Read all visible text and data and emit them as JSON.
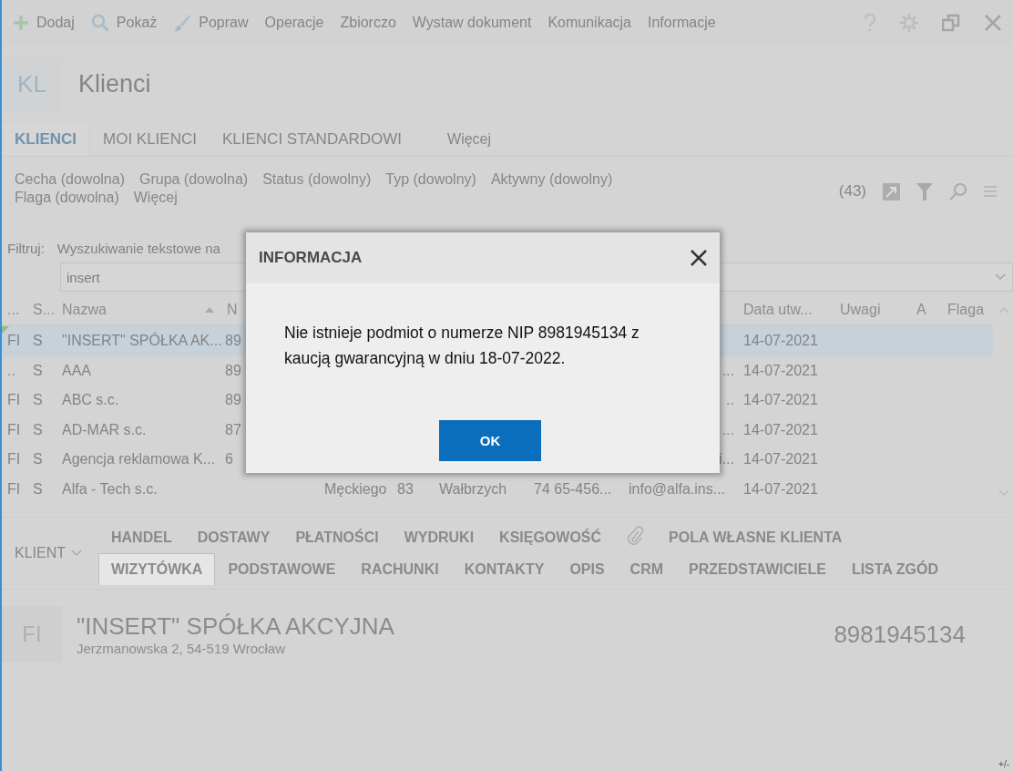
{
  "toolbar": {
    "items": [
      {
        "kind": "add",
        "label": "Dodaj"
      },
      {
        "kind": "search",
        "label": "Pokaż"
      },
      {
        "kind": "brush",
        "label": "Popraw"
      },
      {
        "kind": "menu",
        "label": "Operacje"
      },
      {
        "kind": "menu",
        "label": "Zbiorczo"
      },
      {
        "kind": "menu",
        "label": "Wystaw dokument"
      },
      {
        "kind": "menu",
        "label": "Komunikacja"
      },
      {
        "kind": "menu",
        "label": "Informacje"
      }
    ]
  },
  "module": {
    "badge": "KL",
    "title": "Klienci"
  },
  "tabs": [
    {
      "label": "KLIENCI",
      "selected": true
    },
    {
      "label": "MOI KLIENCI",
      "selected": false
    },
    {
      "label": "KLIENCI STANDARDOWI",
      "selected": false
    }
  ],
  "tabs_more": "Więcej",
  "filters": {
    "line_1": [
      "Cecha (dowolna)",
      "Grupa (dowolna)",
      "Status (dowolny)",
      "Typ (dowolny)",
      "Aktywny (dowolny)"
    ],
    "line_2": [
      "Flaga (dowolna)",
      "Więcej"
    ],
    "count": "(43)"
  },
  "search": {
    "label": "Filtruj:",
    "mode": "Wyszukiwanie tekstowe na",
    "value": "insert"
  },
  "table": {
    "columns": [
      {
        "label": "..."
      },
      {
        "label": "S..."
      },
      {
        "label": "Nazwa",
        "sorted": true
      },
      {
        "label": "N"
      },
      {},
      {},
      {},
      {},
      {},
      {
        "label": "Data utw..."
      },
      {
        "label": "Uwagi"
      },
      {
        "label": "A"
      },
      {
        "label": "Flaga"
      }
    ],
    "rows": [
      {
        "selected": true,
        "cells": [
          "FI",
          "S",
          "\"INSERT\" SPÓŁKA AK...",
          "89",
          "",
          "",
          "",
          "",
          "",
          "14-07-2021"
        ]
      },
      {
        "selected": false,
        "cells": [
          "..",
          "S",
          "AAA",
          "89",
          "",
          "",
          "",
          "",
          "...",
          "14-07-2021"
        ]
      },
      {
        "selected": false,
        "cells": [
          "FI",
          "S",
          "ABC s.c.",
          "89",
          "",
          "",
          "",
          "",
          "..",
          "14-07-2021"
        ]
      },
      {
        "selected": false,
        "cells": [
          "FI",
          "S",
          "AD-MAR s.c.",
          "87",
          "",
          "",
          "",
          "",
          "...",
          "14-07-2021"
        ]
      },
      {
        "selected": false,
        "cells": [
          "FI",
          "S",
          "Agencja reklamowa K...",
          "6",
          "",
          "",
          "",
          "",
          "i...",
          "14-07-2021"
        ]
      },
      {
        "selected": false,
        "cells": [
          "FI",
          "S",
          "Alfa - Tech s.c.",
          "",
          "Męckiego",
          "83",
          "Wałbrzych",
          "74 65-456...",
          "info@alfa.ins...",
          "14-07-2021"
        ]
      }
    ]
  },
  "detail": {
    "group": "KLIENT",
    "tabs_top": [
      {
        "kind": "text",
        "label": "HANDEL"
      },
      {
        "kind": "text",
        "label": "DOSTAWY"
      },
      {
        "kind": "text",
        "label": "PŁATNOŚCI"
      },
      {
        "kind": "text",
        "label": "WYDRUKI"
      },
      {
        "kind": "text",
        "label": "KSIĘGOWOŚĆ"
      },
      {
        "kind": "attachment"
      },
      {
        "kind": "text",
        "label": "POLA WŁASNE KLIENTA"
      }
    ],
    "tabs_bottom": [
      {
        "label": "WIZYTÓWKA",
        "selected": true
      },
      {
        "label": "PODSTAWOWE",
        "selected": false
      },
      {
        "label": "RACHUNKI",
        "selected": false
      },
      {
        "label": "KONTAKTY",
        "selected": false
      },
      {
        "label": "OPIS",
        "selected": false
      },
      {
        "label": "CRM",
        "selected": false
      },
      {
        "label": "PRZEDSTAWICIELE",
        "selected": false
      },
      {
        "label": "LISTA ZGÓD",
        "selected": false
      }
    ],
    "card": {
      "badge": "FI",
      "name": "\"INSERT\" SPÓŁKA AKCYJNA",
      "address": "Jerzmanowska 2, 54-519 Wrocław",
      "nip": "8981945134"
    }
  },
  "corner": "+/-",
  "dialog": {
    "title": "INFORMACJA",
    "message": "Nie istnieje podmiot o numerze NIP 8981945134 z kaucją gwarancyjną w dniu 18-07-2022.",
    "button": "OK"
  }
}
